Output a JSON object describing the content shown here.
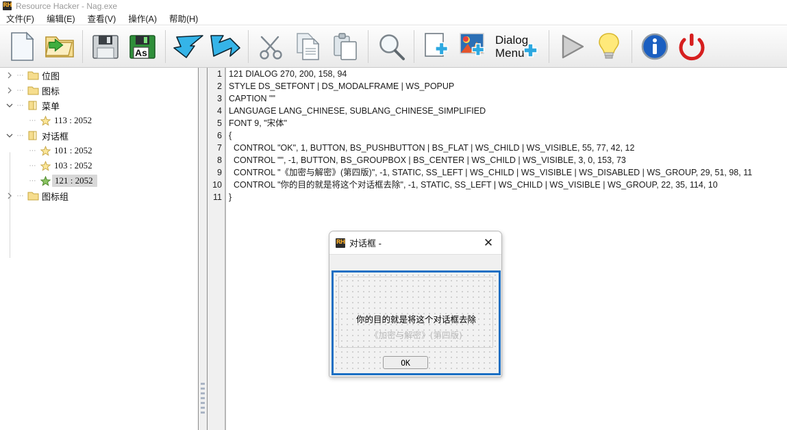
{
  "window": {
    "icon": "rh-app-icon",
    "icon_text": "RH",
    "title": "Resource Hacker - Nag.exe"
  },
  "menubar": {
    "items": [
      {
        "label": "文件(F)",
        "name": "menu-file"
      },
      {
        "label": "编辑(E)",
        "name": "menu-edit"
      },
      {
        "label": "查看(V)",
        "name": "menu-view"
      },
      {
        "label": "操作(A)",
        "name": "menu-action"
      },
      {
        "label": "帮助(H)",
        "name": "menu-help"
      }
    ]
  },
  "toolbar": {
    "buttons": [
      {
        "icon": "new-file-icon",
        "group": 0
      },
      {
        "icon": "open-folder-icon",
        "group": 0
      },
      {
        "icon": "save-icon",
        "group": 1
      },
      {
        "icon": "save-as-icon",
        "group": 1
      },
      {
        "icon": "arrow-in-icon",
        "group": 2
      },
      {
        "icon": "arrow-out-icon",
        "group": 2
      },
      {
        "icon": "cut-scissors-icon",
        "group": 3
      },
      {
        "icon": "copy-icon",
        "group": 3
      },
      {
        "icon": "paste-icon",
        "group": 3
      },
      {
        "icon": "find-magnifier-icon",
        "group": 4
      },
      {
        "icon": "add-resource-icon",
        "group": 5
      },
      {
        "icon": "add-image-icon",
        "group": 5
      },
      {
        "icon": "add-dialog-menu-icon",
        "group": 5,
        "label_line1": "Dialog",
        "label_line2": "Menu"
      },
      {
        "icon": "run-play-icon",
        "group": 6
      },
      {
        "icon": "lightbulb-icon",
        "group": 6
      },
      {
        "icon": "info-icon",
        "group": 7
      },
      {
        "icon": "power-exit-icon",
        "group": 7
      }
    ]
  },
  "tree": {
    "items": [
      {
        "label": "位图",
        "level": 0,
        "expander": "collapsed",
        "icon": "folder-closed-icon",
        "selected": false
      },
      {
        "label": "图标",
        "level": 0,
        "expander": "collapsed",
        "icon": "folder-closed-icon",
        "selected": false
      },
      {
        "label": "菜单",
        "level": 0,
        "expander": "expanded",
        "icon": "folder-open-icon",
        "selected": false
      },
      {
        "label": "113 : 2052",
        "level": 1,
        "expander": "none",
        "icon": "star-yellow-icon",
        "selected": false
      },
      {
        "label": "对话框",
        "level": 0,
        "expander": "expanded",
        "icon": "folder-open-icon",
        "selected": false
      },
      {
        "label": "101 : 2052",
        "level": 1,
        "expander": "none",
        "icon": "star-yellow-icon",
        "selected": false
      },
      {
        "label": "103 : 2052",
        "level": 1,
        "expander": "none",
        "icon": "star-yellow-icon",
        "selected": false
      },
      {
        "label": "121 : 2052",
        "level": 1,
        "expander": "none",
        "icon": "star-green-icon",
        "selected": true
      },
      {
        "label": "图标组",
        "level": 0,
        "expander": "collapsed",
        "icon": "folder-closed-icon",
        "selected": false
      }
    ]
  },
  "editor": {
    "line_numbers": [
      "1",
      "2",
      "3",
      "4",
      "5",
      "6",
      "7",
      "8",
      "9",
      "10",
      "11"
    ],
    "lines": [
      "121 DIALOG 270, 200, 158, 94",
      "STYLE DS_SETFONT | DS_MODALFRAME | WS_POPUP",
      "CAPTION \"\"",
      "LANGUAGE LANG_CHINESE, SUBLANG_CHINESE_SIMPLIFIED",
      "FONT 9, \"宋体\"",
      "{",
      "  CONTROL \"OK\", 1, BUTTON, BS_PUSHBUTTON | BS_FLAT | WS_CHILD | WS_VISIBLE, 55, 77, 42, 12",
      "  CONTROL \"\", -1, BUTTON, BS_GROUPBOX | BS_CENTER | WS_CHILD | WS_VISIBLE, 3, 0, 153, 73",
      "  CONTROL \"《加密与解密》(第四版)\", -1, STATIC, SS_LEFT | WS_CHILD | WS_VISIBLE | WS_DISABLED | WS_GROUP, 29, 51, 98, 11",
      "  CONTROL \"你的目的就是将这个对话框去除\", -1, STATIC, SS_LEFT | WS_CHILD | WS_VISIBLE | WS_GROUP, 22, 35, 114, 10",
      "}"
    ]
  },
  "dialog_preview": {
    "icon": "rh-app-icon",
    "icon_text": "RH",
    "title": "对话框 -",
    "close_glyph": "✕",
    "static_main": "你的目的就是将这个对话框去除",
    "static_disabled": "《加密与解密》(第四版)",
    "ok_button": "OK"
  },
  "colors": {
    "accent_blue": "#1a6fc4",
    "toolbar_bg": "#f3f3f3",
    "selection_gray": "#d8d8d8",
    "star_yellow": "#f5d76e",
    "star_green": "#7cbf4f",
    "power_red": "#d61f1f",
    "info_blue": "#1b5fc1"
  }
}
